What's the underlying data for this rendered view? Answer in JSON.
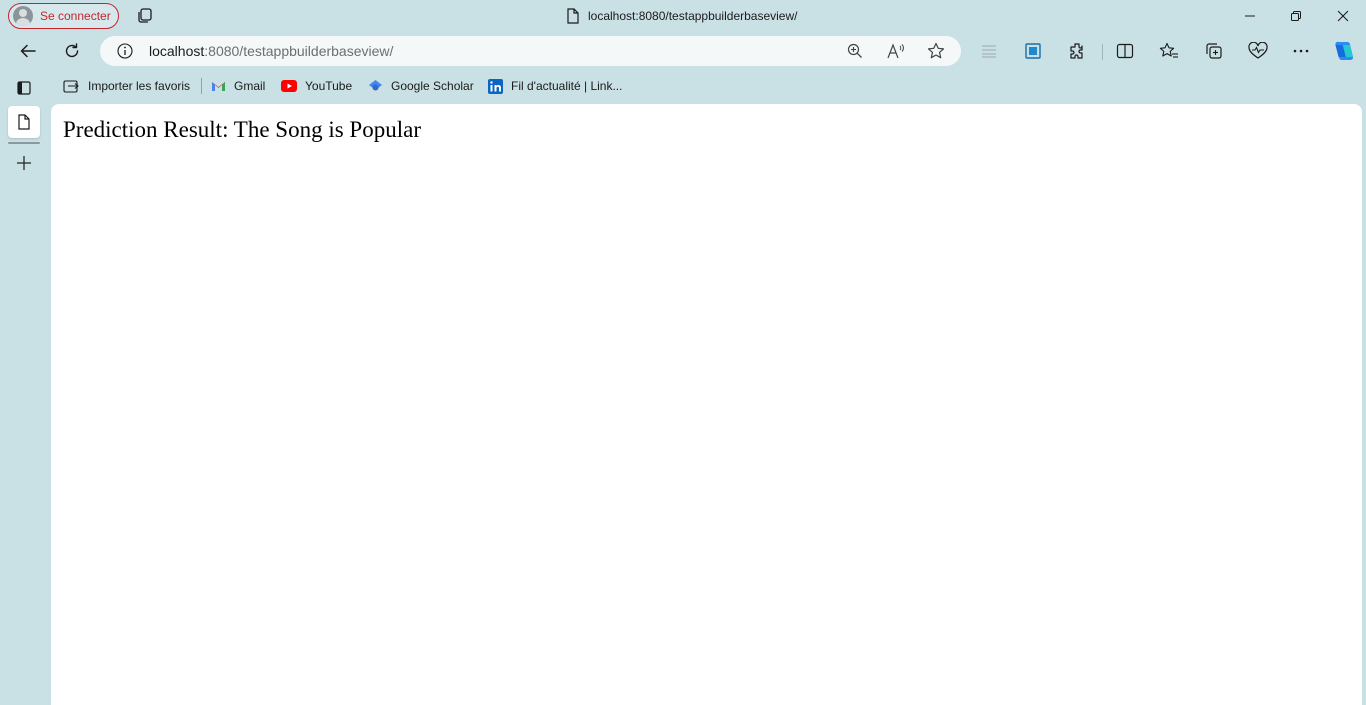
{
  "titlebar": {
    "profile_label": "Se connecter",
    "page_title": "localhost:8080/testappbuilderbaseview/"
  },
  "addressbar": {
    "url_host": "localhost",
    "url_rest": ":8080/testappbuilderbaseview/"
  },
  "favorites": [
    {
      "label": "Importer les favoris",
      "icon": "import-favorites-icon"
    },
    {
      "label": "Gmail",
      "icon": "gmail-icon"
    },
    {
      "label": "YouTube",
      "icon": "youtube-icon"
    },
    {
      "label": "Google Scholar",
      "icon": "google-scholar-icon"
    },
    {
      "label": "Fil d'actualité | Link...",
      "icon": "linkedin-icon"
    }
  ],
  "page": {
    "heading": "Prediction Result: The Song is Popular"
  },
  "colors": {
    "chrome_background": "#c9e0e4",
    "profile_accent": "#c4262e",
    "page_background": "#ffffff"
  }
}
